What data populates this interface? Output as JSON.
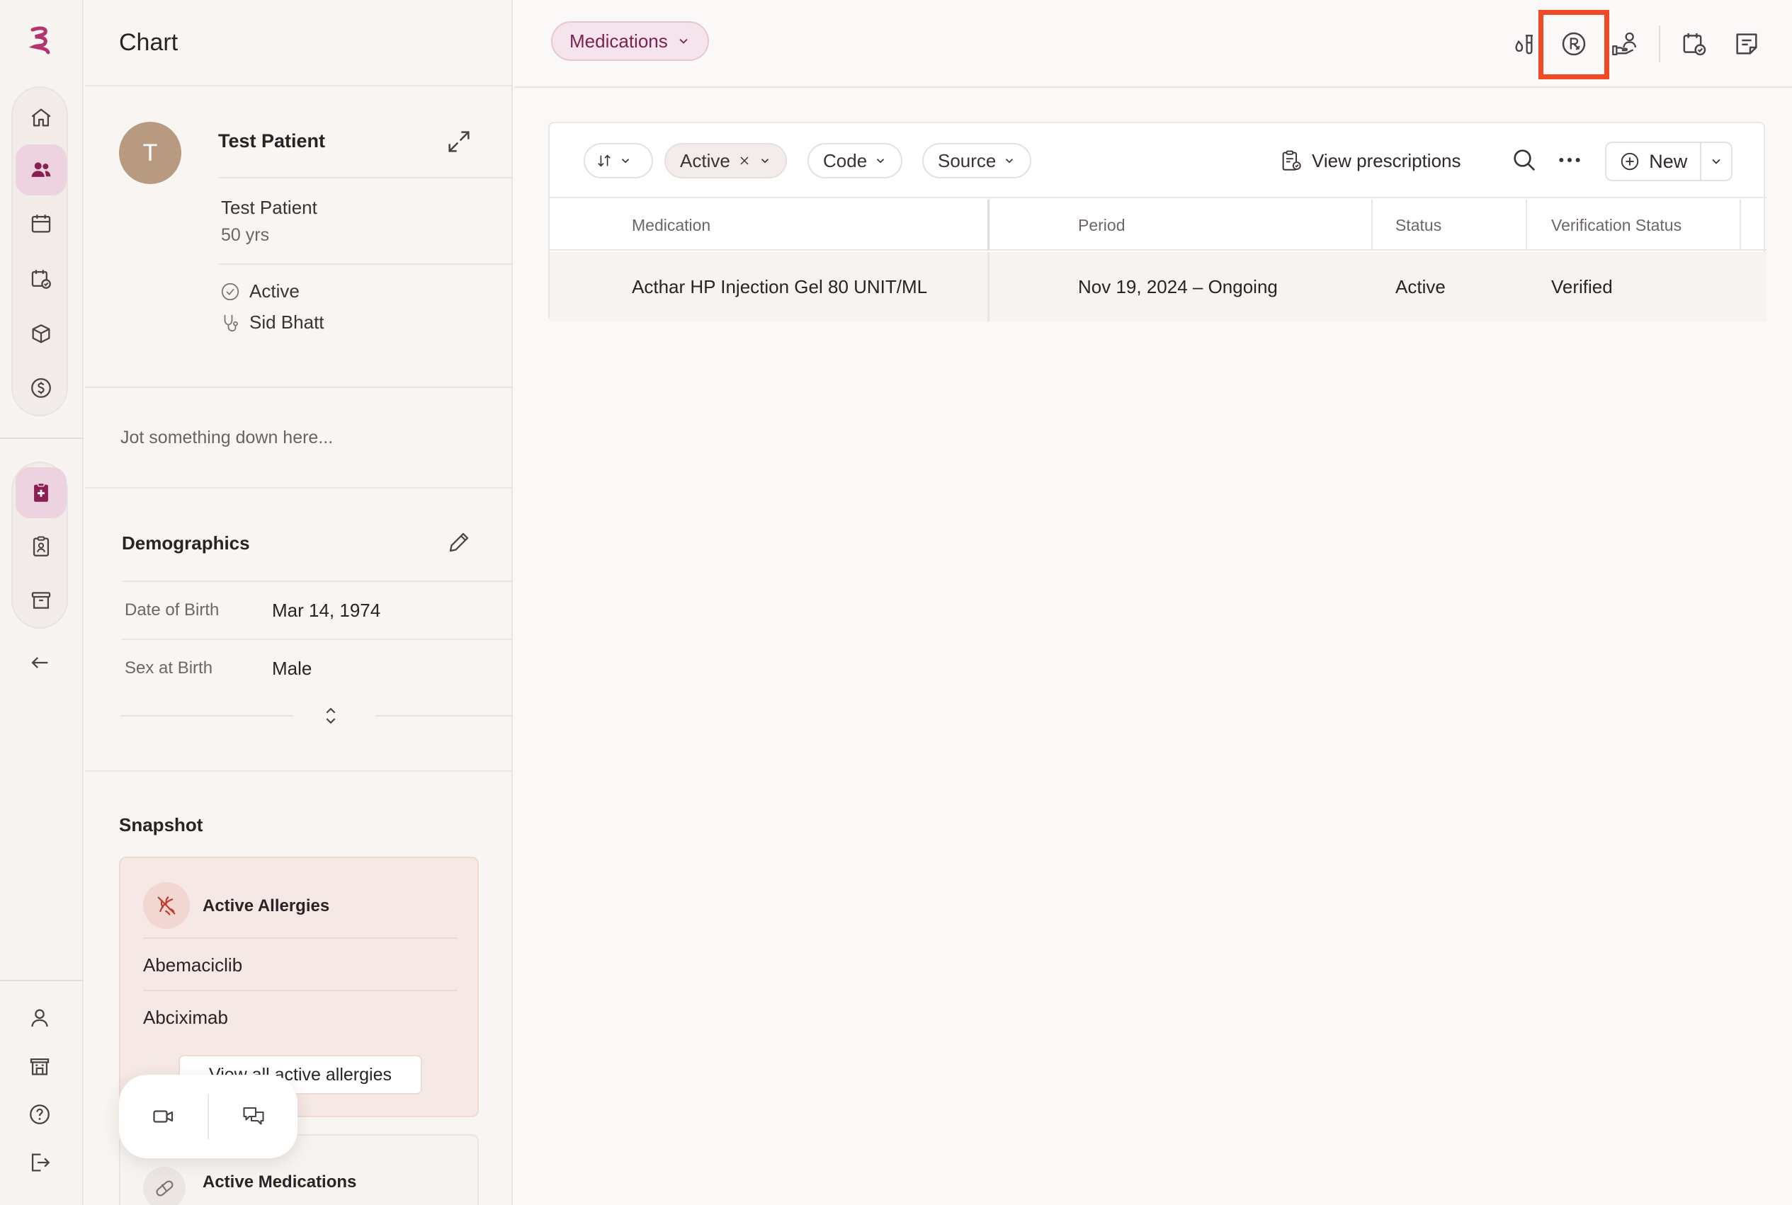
{
  "panel": {
    "title": "Chart",
    "patient": {
      "initial": "T",
      "name": "Test Patient",
      "sub_name": "Test Patient",
      "age": "50 yrs",
      "status": "Active",
      "provider": "Sid Bhatt"
    },
    "jot_placeholder": "Jot something down here...",
    "demographics": {
      "title": "Demographics",
      "rows": [
        {
          "label": "Date of Birth",
          "value": "Mar 14, 1974"
        },
        {
          "label": "Sex at Birth",
          "value": "Male"
        }
      ]
    },
    "snapshot": {
      "title": "Snapshot",
      "allergies": {
        "title": "Active Allergies",
        "items": [
          "Abemaciclib",
          "Abciximab"
        ],
        "view_all": "View all active allergies"
      },
      "medications": {
        "title": "Active Medications"
      }
    }
  },
  "main": {
    "section_selector": "Medications",
    "toolbar": {
      "filter_active": "Active",
      "filter_code": "Code",
      "filter_source": "Source",
      "view_prescriptions": "View prescriptions",
      "new_label": "New"
    },
    "table": {
      "columns": [
        "Medication",
        "Period",
        "Status",
        "Verification Status"
      ],
      "rows": [
        {
          "medication": "Acthar HP Injection Gel 80 UNIT/ML",
          "period": "Nov 19, 2024 – Ongoing",
          "status": "Active",
          "verification": "Verified"
        }
      ]
    }
  },
  "colors": {
    "brand": "#b5336f",
    "highlight": "#ef4a25",
    "pill_bg": "#f6e4ec",
    "pill_text": "#7a2250"
  },
  "icons": {
    "rail": [
      "home-icon",
      "patients-icon",
      "calendar-icon",
      "calendar-check-icon",
      "package-icon",
      "dollar-icon",
      "clipboard-plus-icon",
      "clipboard-user-icon",
      "archive-icon",
      "back-arrow-icon",
      "user-icon",
      "building-icon",
      "help-icon",
      "logout-icon"
    ],
    "topbar": [
      "lab-tube-icon",
      "prescription-icon",
      "care-team-icon",
      "calendar-check-icon",
      "note-icon"
    ]
  }
}
